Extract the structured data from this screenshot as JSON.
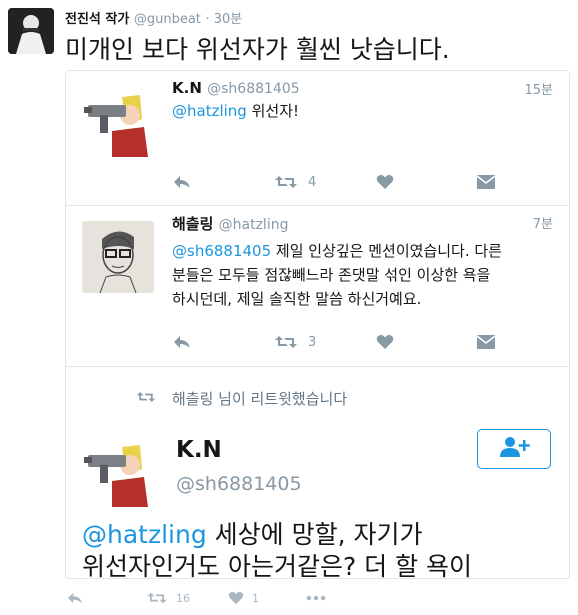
{
  "header": {
    "author_name": "전진석 작가",
    "author_handle": "@gunbeat",
    "time": "· 30분",
    "text": "미개인 보다 위선자가 훨씬 낫습니다."
  },
  "quote": {
    "tweet1": {
      "name": "K.N",
      "handle": "@sh6881405",
      "time": "15분",
      "mention": "@hatzling",
      "text": " 위선자!",
      "retweet_count": "4"
    },
    "tweet2": {
      "name": "해츨링",
      "handle": "@hatzling",
      "time": "7분",
      "mention": "@sh6881405",
      "text_line1": " 제일 인상깊은 멘션이였습니다. 다른",
      "text_line2": "분들은 모두들 점잖빼느라 존댓말 섞인 이상한 욕을",
      "text_line3": "하시던데, 제일 솔직한 말씀 하신거예요.",
      "retweet_count": "3"
    },
    "retweet_notice": "해츨링 님이 리트윗했습니다",
    "tweet3": {
      "name": "K.N",
      "handle": "@sh6881405",
      "mention": "@hatzling",
      "text_line1": " 세상에 망할, 자기가",
      "text_line2": "위선자인거도 아는거같은? 더 할 욕이"
    }
  },
  "bottom": {
    "retweet_count": "16",
    "like_count": "1"
  },
  "colors": {
    "accent": "#1b95e0",
    "muted": "#8899a6",
    "border": "#e1e8ed"
  },
  "icons": [
    "reply-icon",
    "retweet-icon",
    "like-icon",
    "message-icon",
    "more-icon",
    "follow-icon"
  ]
}
